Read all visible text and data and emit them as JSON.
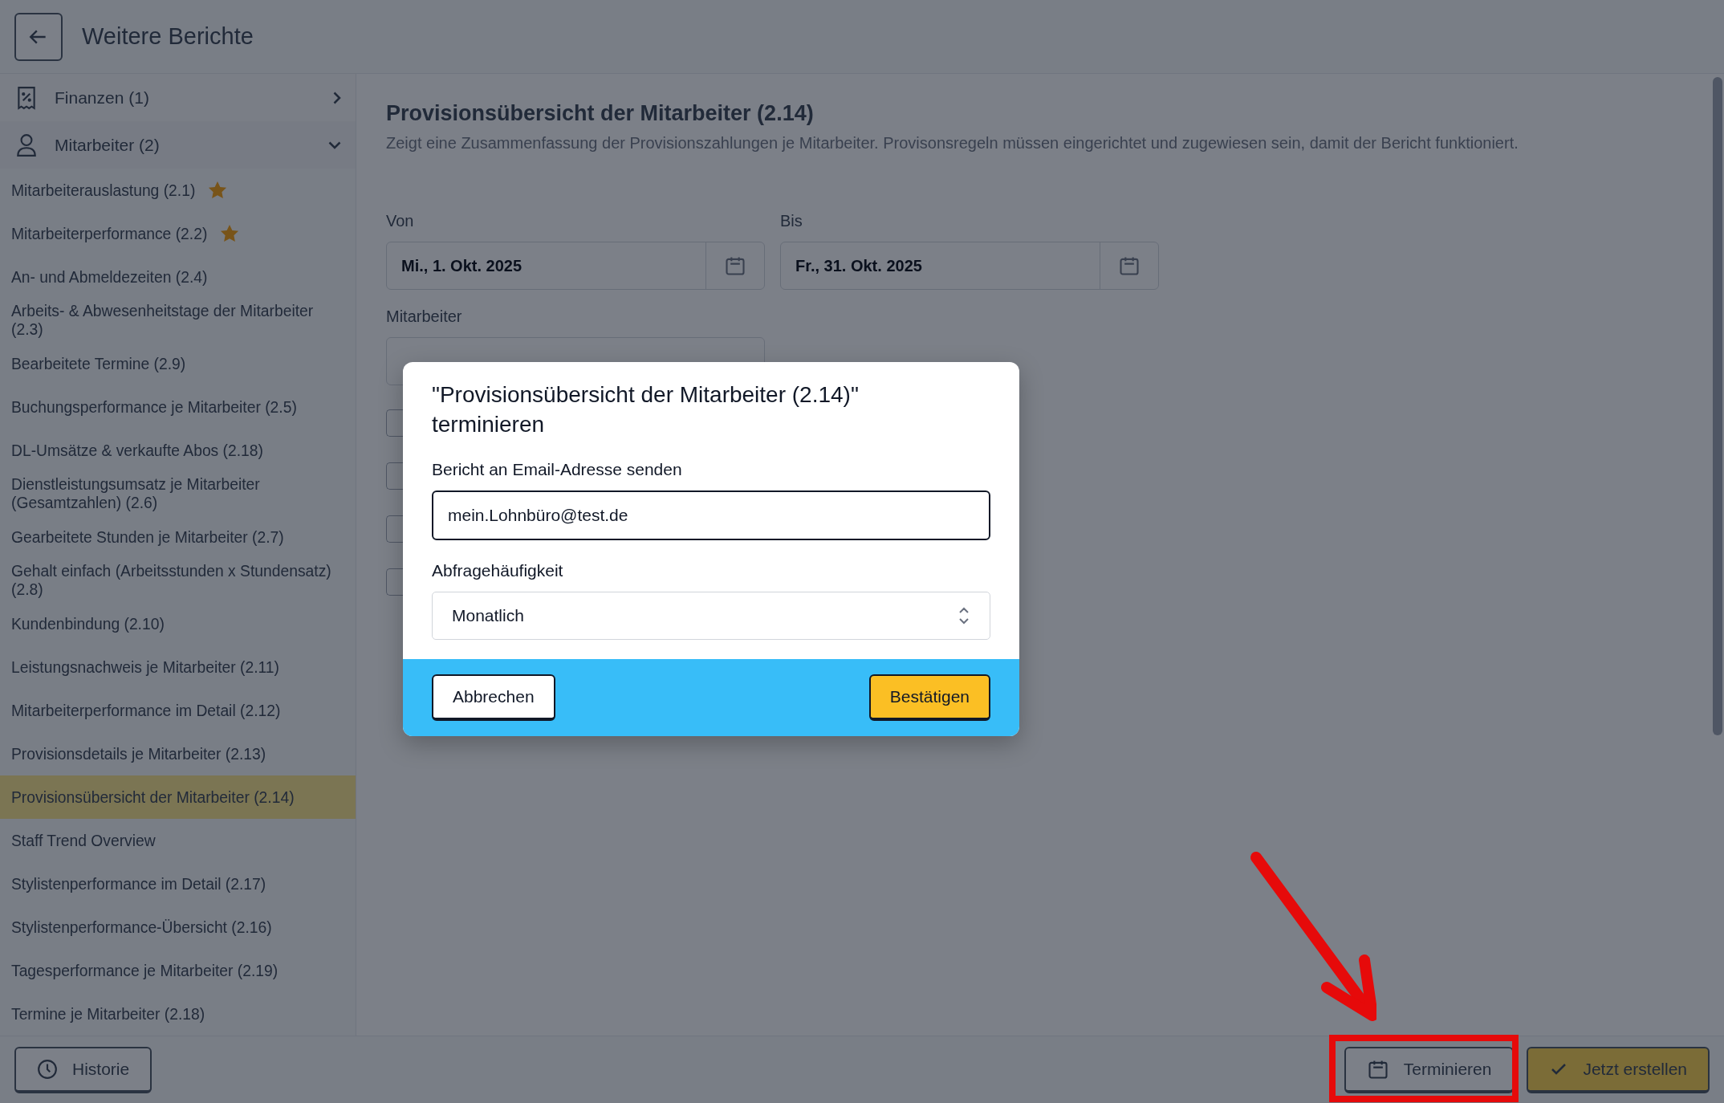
{
  "header": {
    "title": "Weitere Berichte"
  },
  "sidebar": {
    "groups": [
      {
        "label": "Finanzen (1)",
        "expanded": false
      },
      {
        "label": "Mitarbeiter (2)",
        "expanded": true,
        "children": [
          {
            "label": "Mitarbeiterauslastung (2.1)",
            "starred": true,
            "selected": false
          },
          {
            "label": "Mitarbeiterperformance (2.2)",
            "starred": true,
            "selected": false
          },
          {
            "label": "An- und Abmeldezeiten (2.4)",
            "starred": false,
            "selected": false
          },
          {
            "label": "Arbeits- & Abwesenheitstage der Mitarbeiter (2.3)",
            "starred": false,
            "selected": false
          },
          {
            "label": "Bearbeitete Termine (2.9)",
            "starred": false,
            "selected": false
          },
          {
            "label": "Buchungsperformance je Mitarbeiter (2.5)",
            "starred": false,
            "selected": false
          },
          {
            "label": "DL-Umsätze & verkaufte Abos (2.18)",
            "starred": false,
            "selected": false
          },
          {
            "label": "Dienstleistungsumsatz je Mitarbeiter (Gesamtzahlen) (2.6)",
            "starred": false,
            "selected": false
          },
          {
            "label": "Gearbeitete Stunden je Mitarbeiter (2.7)",
            "starred": false,
            "selected": false
          },
          {
            "label": "Gehalt einfach (Arbeitsstunden x Stundensatz) (2.8)",
            "starred": false,
            "selected": false
          },
          {
            "label": "Kundenbindung (2.10)",
            "starred": false,
            "selected": false
          },
          {
            "label": "Leistungsnachweis je Mitarbeiter (2.11)",
            "starred": false,
            "selected": false
          },
          {
            "label": "Mitarbeiterperformance im Detail (2.12)",
            "starred": false,
            "selected": false
          },
          {
            "label": "Provisionsdetails je Mitarbeiter (2.13)",
            "starred": false,
            "selected": false
          },
          {
            "label": "Provisionsübersicht der Mitarbeiter (2.14)",
            "starred": false,
            "selected": true
          },
          {
            "label": "Staff Trend Overview",
            "starred": false,
            "selected": false
          },
          {
            "label": "Stylistenperformance im Detail (2.17)",
            "starred": false,
            "selected": false
          },
          {
            "label": "Stylistenperformance-Übersicht (2.16)",
            "starred": false,
            "selected": false
          },
          {
            "label": "Tagesperformance je Mitarbeiter (2.19)",
            "starred": false,
            "selected": false
          },
          {
            "label": "Termine je Mitarbeiter (2.18)",
            "starred": false,
            "selected": false
          }
        ]
      }
    ]
  },
  "report": {
    "title": "Provisionsübersicht der Mitarbeiter (2.14)",
    "description": "Zeigt eine Zusammenfassung der Provisionszahlungen je Mitarbeiter. Provisonsregeln müssen eingerichtet und zugewiesen sein, damit der Bericht funktioniert.",
    "date_from": {
      "label": "Von",
      "value": "Mi., 1. Okt. 2025"
    },
    "date_to": {
      "label": "Bis",
      "value": "Fr., 31. Okt. 2025"
    },
    "staff_select": {
      "label": "Mitarbeiter"
    },
    "checkboxes": [
      {
        "checked": false
      },
      {
        "checked": false
      },
      {
        "checked": false
      },
      {
        "checked": false
      }
    ]
  },
  "modal": {
    "title": "\"Provisionsübersicht der Mitarbeiter (2.14)\" terminieren",
    "email": {
      "label": "Bericht an Email-Adresse senden",
      "value": "mein.Lohnbüro@test.de"
    },
    "frequency": {
      "label": "Abfragehäufigkeit",
      "value": "Monatlich"
    },
    "cancel_button": "Abbrechen",
    "confirm_button": "Bestätigen"
  },
  "bottom_bar": {
    "history_button": "Historie",
    "schedule_button": "Terminieren",
    "create_button": "Jetzt erstellen"
  }
}
